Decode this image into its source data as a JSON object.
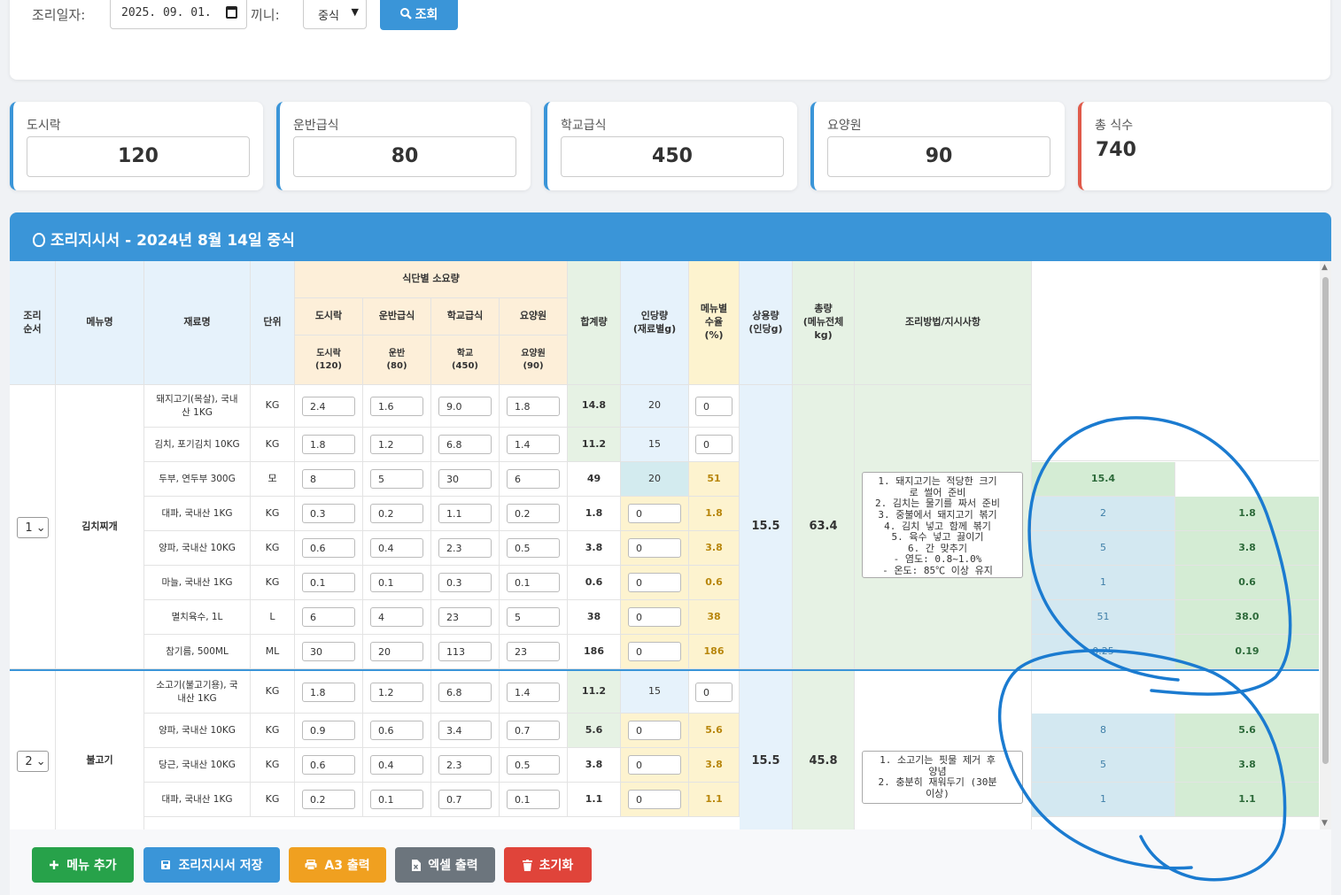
{
  "filter": {
    "date_label": "조리일자:",
    "date_value": "2025. 09. 01.",
    "meal_label": "끼니:",
    "meal_value": "중식",
    "search_label": "조회"
  },
  "stats": [
    {
      "label": "도시락",
      "value": "120"
    },
    {
      "label": "운반급식",
      "value": "80"
    },
    {
      "label": "학교급식",
      "value": "450"
    },
    {
      "label": "요양원",
      "value": "90"
    },
    {
      "label": "총 식수",
      "value": "740"
    }
  ],
  "panel": {
    "title": "조리지시서 - 2024년 8월 14일 중식"
  },
  "headers": {
    "order": "조리\n순서",
    "menu": "메뉴명",
    "ingredient": "재료명",
    "unit": "단위",
    "group": "식단별 소요량",
    "sub": [
      "도시락",
      "운반급식",
      "학교급식",
      "요양원"
    ],
    "sub2": [
      "도시락\n(120)",
      "운반\n(80)",
      "학교\n(450)",
      "요양원\n(90)"
    ],
    "sum": "합계량",
    "per": "인당량\n(재료별g)",
    "yield": "메뉴별\n수율\n(%)",
    "use": "상용량\n(인당g)",
    "total": "총량\n(메뉴전체\nkg)",
    "method": "조리방법/지시사항"
  },
  "menus": [
    {
      "order": "1",
      "name": "김치찌개",
      "use": "15.5",
      "total": "63.4",
      "instructions": "1. 돼지고기는 적당한 크기\n로 썰어 준비\n2. 김치는 물기를 짜서 준비\n3. 중불에서 돼지고기 볶기\n4. 김치 넣고 함께 볶기\n5. 육수 넣고 끓이기\n6. 간 맞추기\n- 염도: 0.8~1.0%\n- 온도: 85℃ 이상 유지",
      "rows": [
        {
          "name": "돼지고기(목살), 국내\n산 1KG",
          "unit": "KG",
          "q": [
            "2.4",
            "1.6",
            "9.0",
            "1.8"
          ],
          "sum": "14.8",
          "per": "20",
          "yield": "0"
        },
        {
          "name": "김치, 포기김치 10KG",
          "unit": "KG",
          "q": [
            "1.8",
            "1.2",
            "6.8",
            "1.4"
          ],
          "sum": "11.2",
          "per": "15",
          "yield": "0"
        },
        {
          "name": "두부, 연두부 300G",
          "unit": "모",
          "q": [
            "8",
            "5",
            "30",
            "6"
          ],
          "sum": "49",
          "per": "20",
          "yield": "51",
          "x1": "15.4"
        },
        {
          "name": "대파, 국내산 1KG",
          "unit": "KG",
          "q": [
            "0.3",
            "0.2",
            "1.1",
            "0.2"
          ],
          "sum": "1.8",
          "per": "0",
          "yield": "1.8",
          "x1": "2",
          "x2": "1.8"
        },
        {
          "name": "양파, 국내산 10KG",
          "unit": "KG",
          "q": [
            "0.6",
            "0.4",
            "2.3",
            "0.5"
          ],
          "sum": "3.8",
          "per": "0",
          "yield": "3.8",
          "x1": "5",
          "x2": "3.8"
        },
        {
          "name": "마늘, 국내산 1KG",
          "unit": "KG",
          "q": [
            "0.1",
            "0.1",
            "0.3",
            "0.1"
          ],
          "sum": "0.6",
          "per": "0",
          "yield": "0.6",
          "x1": "1",
          "x2": "0.6"
        },
        {
          "name": "멸치육수, 1L",
          "unit": "L",
          "q": [
            "6",
            "4",
            "23",
            "5"
          ],
          "sum": "38",
          "per": "0",
          "yield": "38",
          "x1": "51",
          "x2": "38.0"
        },
        {
          "name": "참기름, 500ML",
          "unit": "ML",
          "q": [
            "30",
            "20",
            "113",
            "23"
          ],
          "sum": "186",
          "per": "0",
          "yield": "186",
          "x1": "0.25",
          "x2": "0.19"
        }
      ]
    },
    {
      "order": "2",
      "name": "불고기",
      "use": "15.5",
      "total": "45.8",
      "instructions": "1. 소고기는 핏물 제거 후\n양념\n2. 충분히 재워두기 (30분\n이상)",
      "rows": [
        {
          "name": "소고기(불고기용), 국\n내산 1KG",
          "unit": "KG",
          "q": [
            "1.8",
            "1.2",
            "6.8",
            "1.4"
          ],
          "sum": "11.2",
          "per": "15",
          "yield": "0"
        },
        {
          "name": "양파, 국내산 10KG",
          "unit": "KG",
          "q": [
            "0.9",
            "0.6",
            "3.4",
            "0.7"
          ],
          "sum": "5.6",
          "per": "0",
          "yield": "5.6",
          "x1": "8",
          "x2": "5.6"
        },
        {
          "name": "당근, 국내산 10KG",
          "unit": "KG",
          "q": [
            "0.6",
            "0.4",
            "2.3",
            "0.5"
          ],
          "sum": "3.8",
          "per": "0",
          "yield": "3.8",
          "x1": "5",
          "x2": "3.8"
        },
        {
          "name": "대파, 국내산 1KG",
          "unit": "KG",
          "q": [
            "0.2",
            "0.1",
            "0.7",
            "0.1"
          ],
          "sum": "1.1",
          "per": "0",
          "yield": "1.1",
          "x1": "1",
          "x2": "1.1"
        }
      ]
    }
  ],
  "footer": [
    {
      "label": "메뉴 추가",
      "icon": "plus-icon",
      "color": "#27a24a"
    },
    {
      "label": "조리지시서 저장",
      "icon": "save-icon",
      "color": "#3a95d8"
    },
    {
      "label": "A3 출력",
      "icon": "print-icon",
      "color": "#f0a020"
    },
    {
      "label": "엑셀 출력",
      "icon": "excel-file-icon",
      "color": "#6c757d"
    },
    {
      "label": "초기화",
      "icon": "trash-icon",
      "color": "#e0443a"
    }
  ],
  "colors": {
    "primary": "#3a95d8",
    "annotation": "#1b7bd0",
    "red_accent": "#e05a4a"
  }
}
